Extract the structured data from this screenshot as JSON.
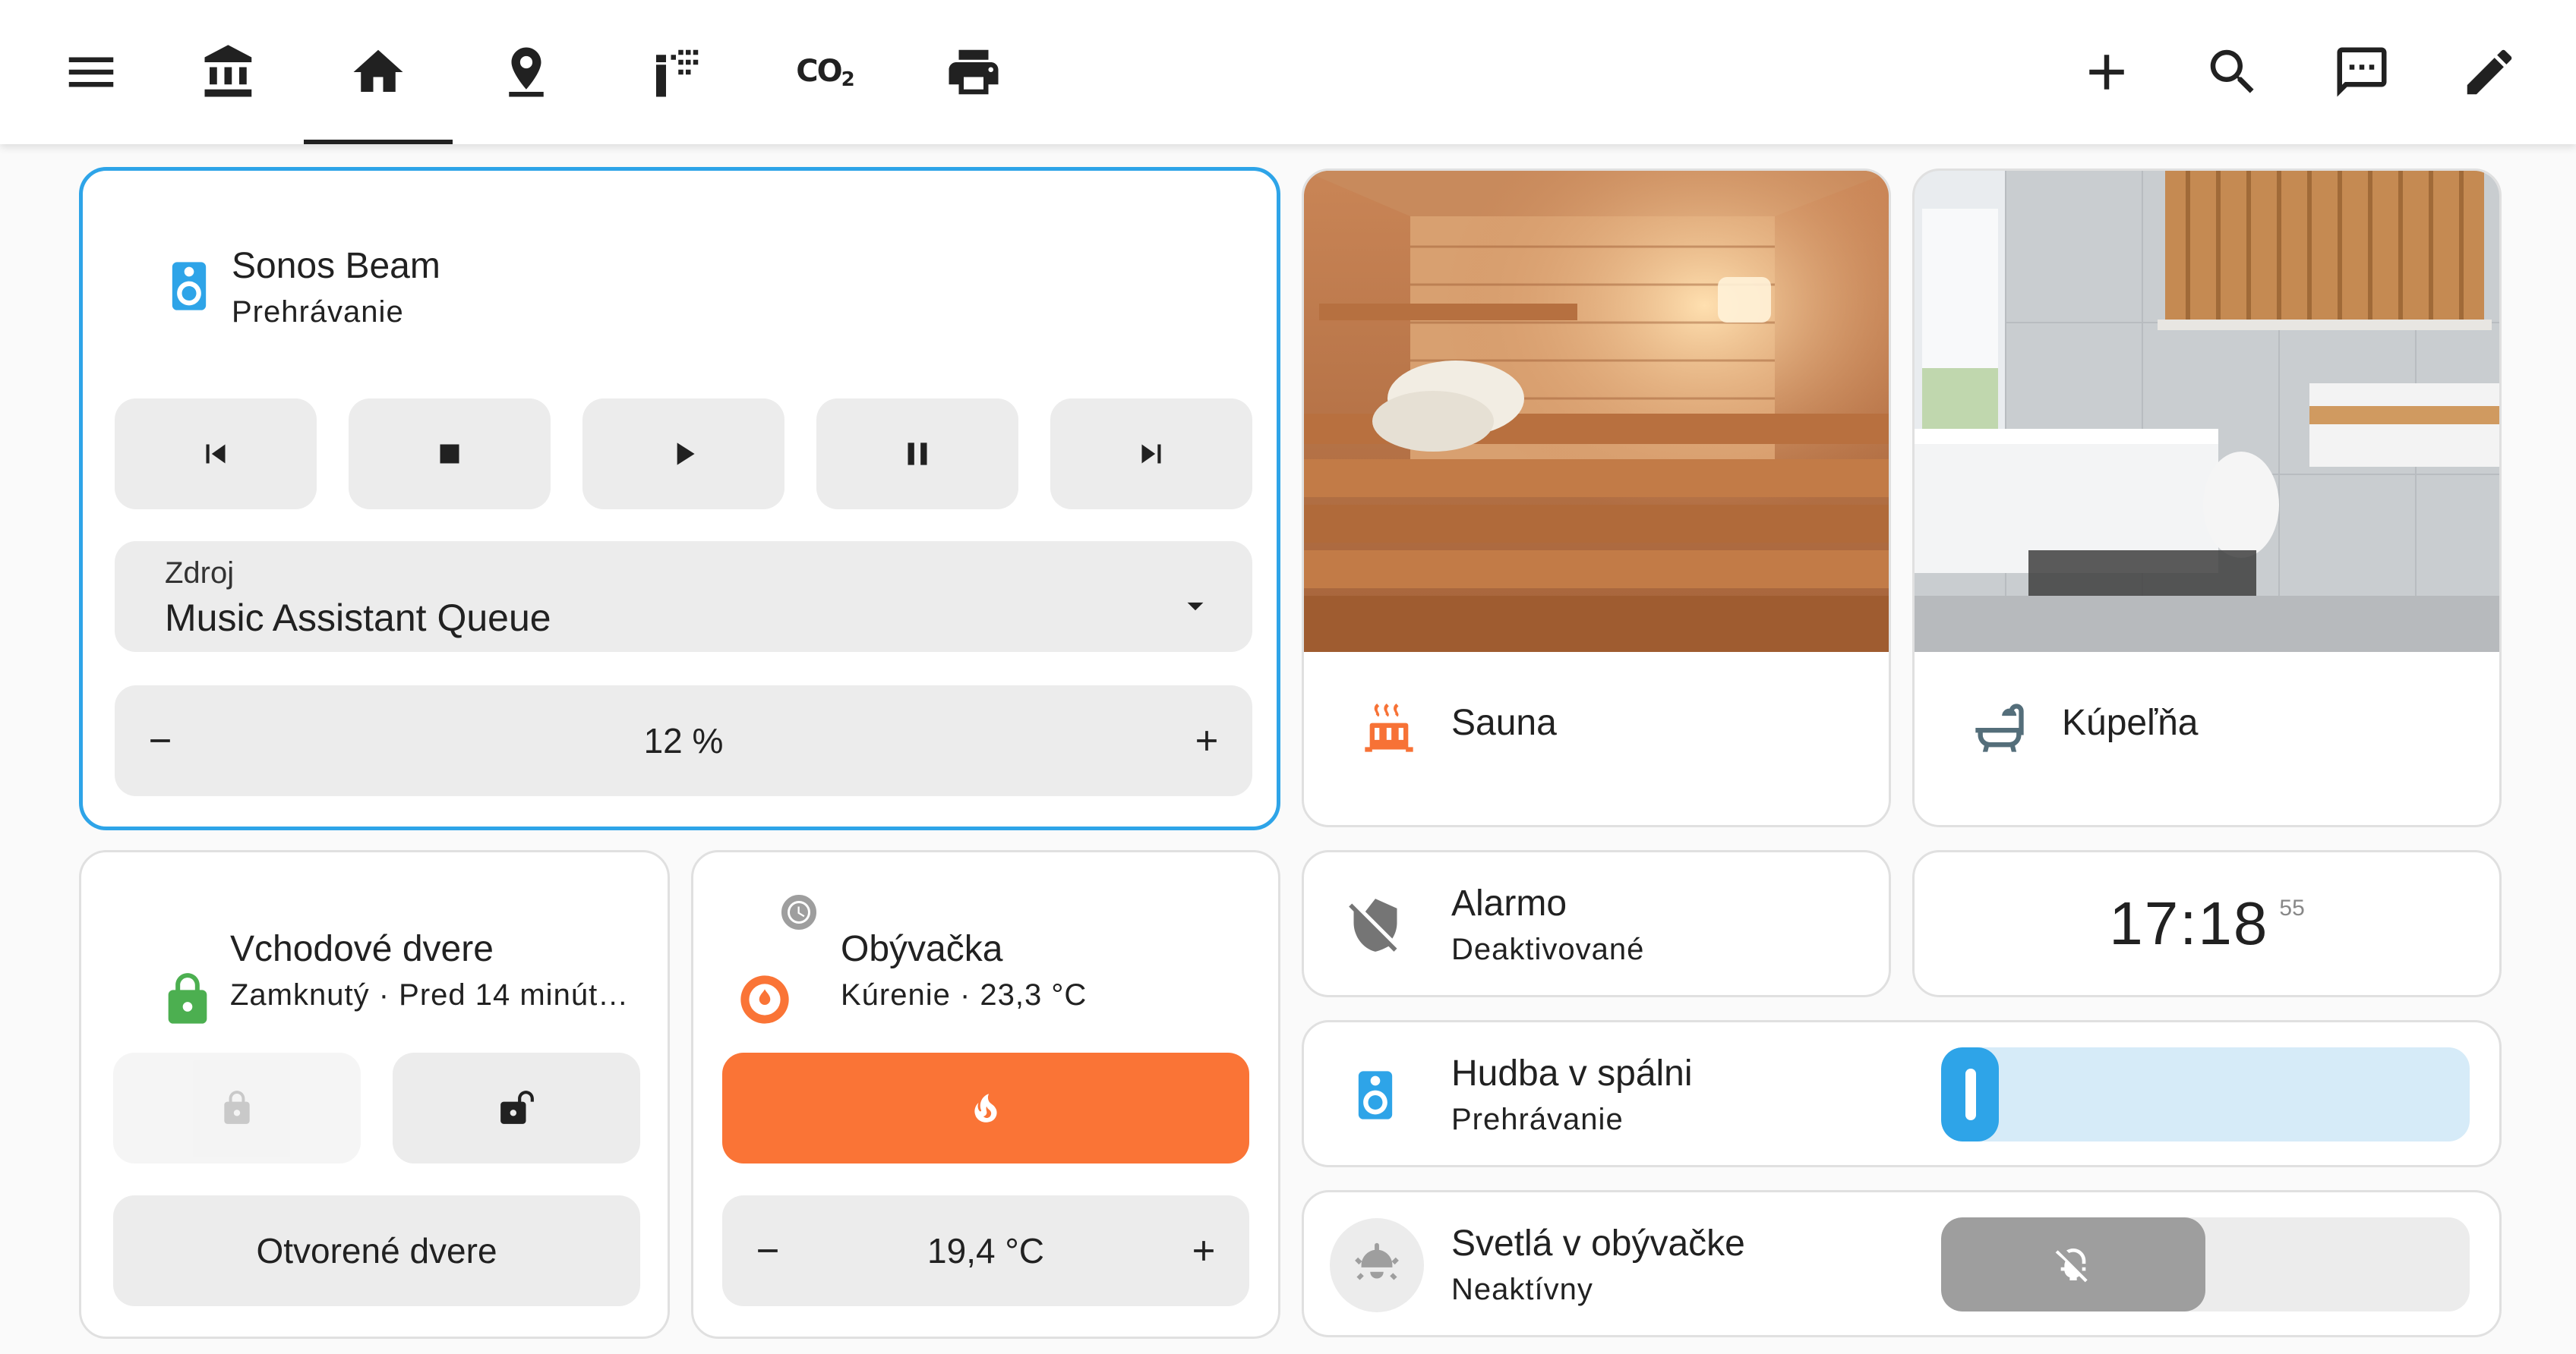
{
  "toolbar": {
    "tabs": [
      {
        "name": "bank-icon"
      },
      {
        "name": "home-icon"
      },
      {
        "name": "map-marker-icon"
      },
      {
        "name": "spray-icon"
      },
      {
        "name": "co2-icon",
        "text": "CO2"
      },
      {
        "name": "printer-icon"
      }
    ],
    "active_tab": 1,
    "right_icons": [
      "plus-icon",
      "search-icon",
      "assist-icon",
      "pencil-icon"
    ]
  },
  "colors": {
    "accent_blue": "#2ea4e8",
    "heat_orange": "#fa7436",
    "lock_green": "#4caf50",
    "sauna_orange": "#f77236"
  },
  "media": {
    "title": "Sonos Beam",
    "state": "Prehrávanie",
    "controls": [
      "previous",
      "stop",
      "play",
      "pause",
      "next"
    ],
    "source_label": "Zdroj",
    "source_value": "Music Assistant Queue",
    "volume": "12 %",
    "volume_minus": "−",
    "volume_plus": "+"
  },
  "areas": [
    {
      "name": "Sauna",
      "icon": "radiator-icon"
    },
    {
      "name": "Kúpeľňa",
      "icon": "bathtub-icon"
    }
  ],
  "lock": {
    "title": "Vchodové dvere",
    "state": "Zamknutý · Pred 14 minút…",
    "open_label": "Otvorené dvere"
  },
  "climate": {
    "title": "Obývačka",
    "state": "Kúrenie · 23,3 °C",
    "target": "19,4 °C",
    "minus": "−",
    "plus": "+"
  },
  "alarm": {
    "title": "Alarmo",
    "state": "Deaktivované"
  },
  "clock": {
    "hm": "17:18",
    "ss": "55"
  },
  "bedroom": {
    "title": "Hudba v spálni",
    "state": "Prehrávanie",
    "level": 0.05
  },
  "lights": {
    "title": "Svetlá v obývačke",
    "state": "Neaktívny"
  }
}
